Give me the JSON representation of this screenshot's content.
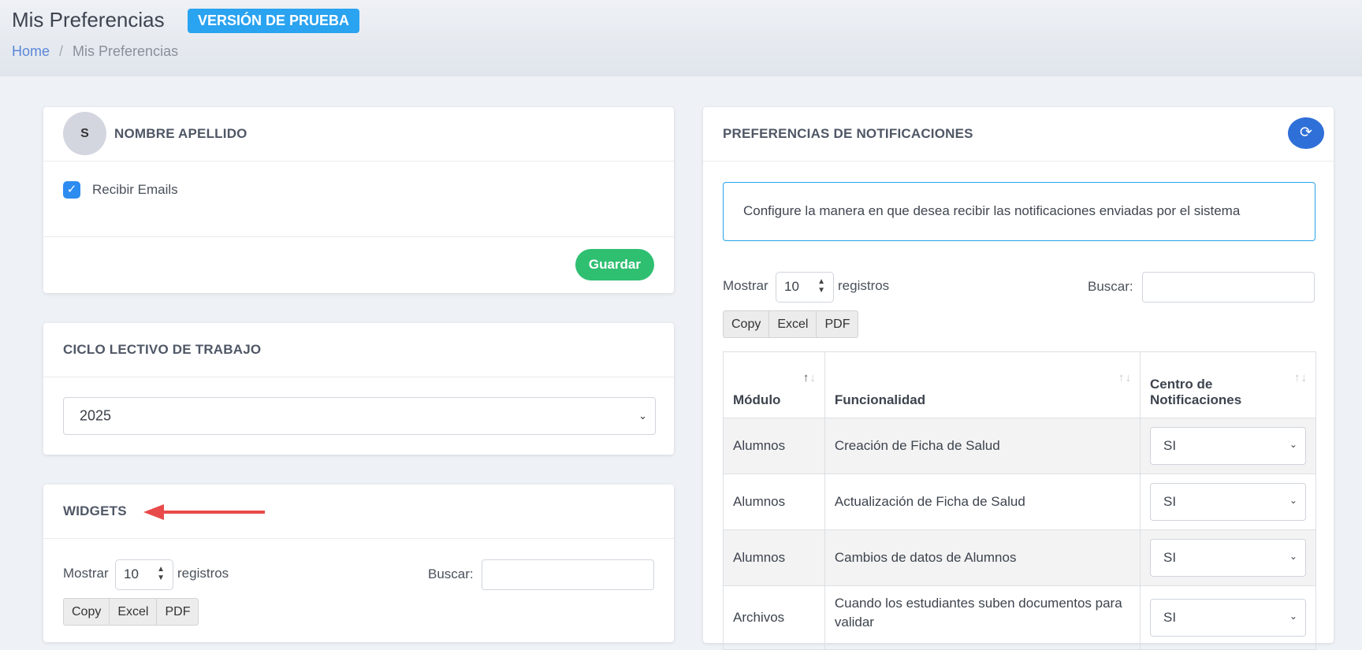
{
  "header": {
    "title": "Mis Preferencias",
    "badge": "VERSIÓN DE PRUEBA",
    "breadcrumb": {
      "home": "Home",
      "separator": "/",
      "current": "Mis Preferencias"
    }
  },
  "user_card": {
    "avatar_initial": "S",
    "name": "NOMBRE APELLIDO",
    "receive_emails_label": "Recibir Emails",
    "receive_emails_checked": true,
    "save_label": "Guardar"
  },
  "ciclo_card": {
    "title": "CICLO LECTIVO DE TRABAJO",
    "selected": "2025"
  },
  "widgets_card": {
    "title": "WIDGETS",
    "show_label": "Mostrar",
    "page_length": "10",
    "records_label": "registros",
    "search_label": "Buscar:",
    "buttons": [
      "Copy",
      "Excel",
      "PDF"
    ]
  },
  "notif_card": {
    "title": "PREFERENCIAS DE NOTIFICACIONES",
    "info": "Configure la manera en que desea recibir las notificaciones enviadas por el sistema",
    "show_label": "Mostrar",
    "page_length": "10",
    "records_label": "registros",
    "search_label": "Buscar:",
    "buttons": [
      "Copy",
      "Excel",
      "PDF"
    ],
    "columns": [
      "Módulo",
      "Funcionalidad",
      "Centro de Notificaciones"
    ],
    "rows": [
      {
        "modulo": "Alumnos",
        "funcionalidad": "Creación de Ficha de Salud",
        "centro": "SI"
      },
      {
        "modulo": "Alumnos",
        "funcionalidad": "Actualización de Ficha de Salud",
        "centro": "SI"
      },
      {
        "modulo": "Alumnos",
        "funcionalidad": "Cambios de datos de Alumnos",
        "centro": "SI"
      },
      {
        "modulo": "Archivos",
        "funcionalidad": "Cuando los estudiantes suben documentos para validar",
        "centro": "SI"
      }
    ]
  },
  "colors": {
    "accent": "#2aa3f0",
    "success": "#2fbf71",
    "primary": "#2f6fd8",
    "annotation_arrow": "#e84a4a"
  }
}
